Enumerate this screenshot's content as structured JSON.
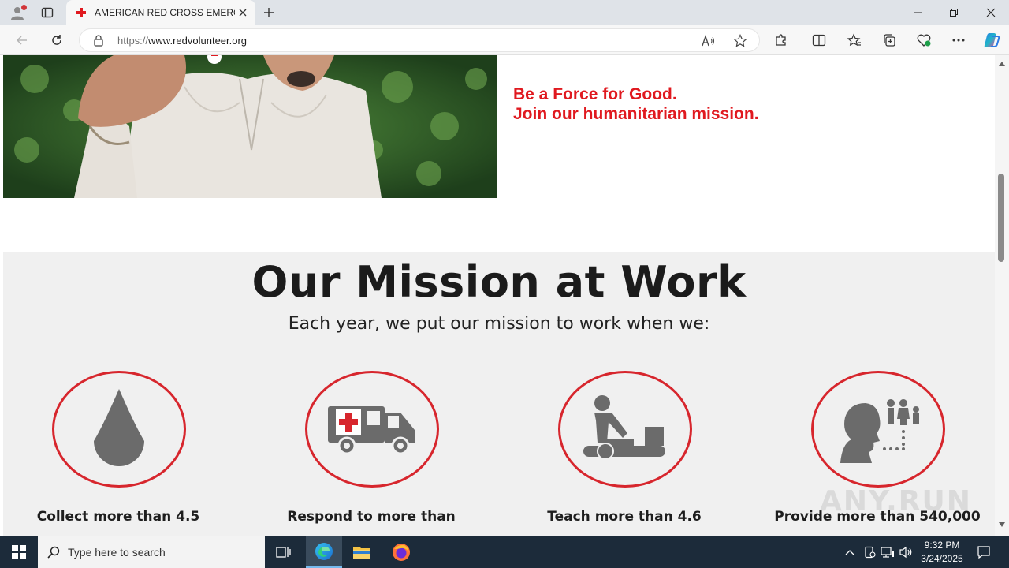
{
  "browser": {
    "tab_title": "AMERICAN RED CROSS EMERGENCY",
    "url_scheme": "https://",
    "url_host": "www.redvolunteer.org"
  },
  "hero": {
    "line1": "Be a Force for Good.",
    "line2": "Join our humanitarian mission."
  },
  "mission": {
    "title": "Our Mission at Work",
    "subtitle": "Each year, we put our mission to work when we:",
    "items": [
      {
        "icon": "blood-drop-icon",
        "text": "Collect more than 4.5"
      },
      {
        "icon": "ambulance-icon",
        "text": "Respond to more than"
      },
      {
        "icon": "cpr-icon",
        "text": "Teach more than 4.6"
      },
      {
        "icon": "family-services-icon",
        "text": "Provide more than 540,000"
      }
    ]
  },
  "watermark": "ANY.RUN",
  "taskbar": {
    "search_placeholder": "Type here to search",
    "time": "9:32 PM",
    "date": "3/24/2025"
  },
  "colors": {
    "accent_red": "#e0191f",
    "circle_red": "#d7262d",
    "icon_gray": "#6b6b6b",
    "taskbar": "#1c2b3a"
  }
}
